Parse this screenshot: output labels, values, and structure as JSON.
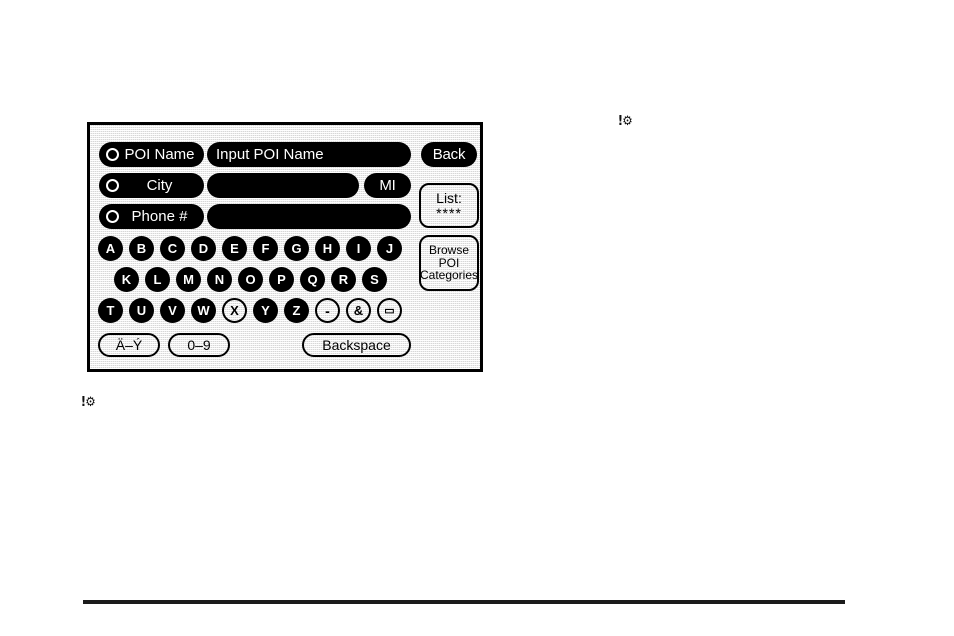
{
  "screen": {
    "title": "POI entry screen",
    "search_rows": [
      {
        "label": "POI Name",
        "value": "Input POI Name",
        "selected": true
      },
      {
        "label": "City",
        "value": "",
        "selected": false
      },
      {
        "label": "Phone #",
        "value": "",
        "selected": false
      }
    ],
    "state_button": "MI",
    "side_buttons": {
      "back": "Back",
      "list_label": "List:",
      "list_count": "****",
      "browse_line1": "Browse",
      "browse_line2": "POI",
      "browse_line3": "Categories"
    },
    "keyboard": {
      "row1": [
        {
          "char": "A",
          "style": "filled"
        },
        {
          "char": "B",
          "style": "filled"
        },
        {
          "char": "C",
          "style": "filled"
        },
        {
          "char": "D",
          "style": "filled"
        },
        {
          "char": "E",
          "style": "filled"
        },
        {
          "char": "F",
          "style": "filled"
        },
        {
          "char": "G",
          "style": "filled"
        },
        {
          "char": "H",
          "style": "filled"
        },
        {
          "char": "I",
          "style": "filled"
        },
        {
          "char": "J",
          "style": "filled"
        }
      ],
      "row2": [
        {
          "char": "K",
          "style": "filled"
        },
        {
          "char": "L",
          "style": "filled"
        },
        {
          "char": "M",
          "style": "filled"
        },
        {
          "char": "N",
          "style": "filled"
        },
        {
          "char": "O",
          "style": "filled"
        },
        {
          "char": "P",
          "style": "filled"
        },
        {
          "char": "Q",
          "style": "filled"
        },
        {
          "char": "R",
          "style": "filled"
        },
        {
          "char": "S",
          "style": "filled"
        }
      ],
      "row3": [
        {
          "char": "T",
          "style": "filled"
        },
        {
          "char": "U",
          "style": "filled"
        },
        {
          "char": "V",
          "style": "filled"
        },
        {
          "char": "W",
          "style": "filled"
        },
        {
          "char": "X",
          "style": "outline"
        },
        {
          "char": "Y",
          "style": "filled"
        },
        {
          "char": "Z",
          "style": "filled"
        },
        {
          "char": "-",
          "style": "outline"
        },
        {
          "char": "&",
          "style": "outline"
        },
        {
          "char": "▭",
          "style": "outline"
        }
      ],
      "accent_key": "Ä–Ý",
      "numeric_key": "0–9",
      "backspace_key": "Backspace"
    }
  },
  "page_marks": {
    "mark_top_right": "!⚙",
    "mark_below_screen": "!⚙"
  }
}
